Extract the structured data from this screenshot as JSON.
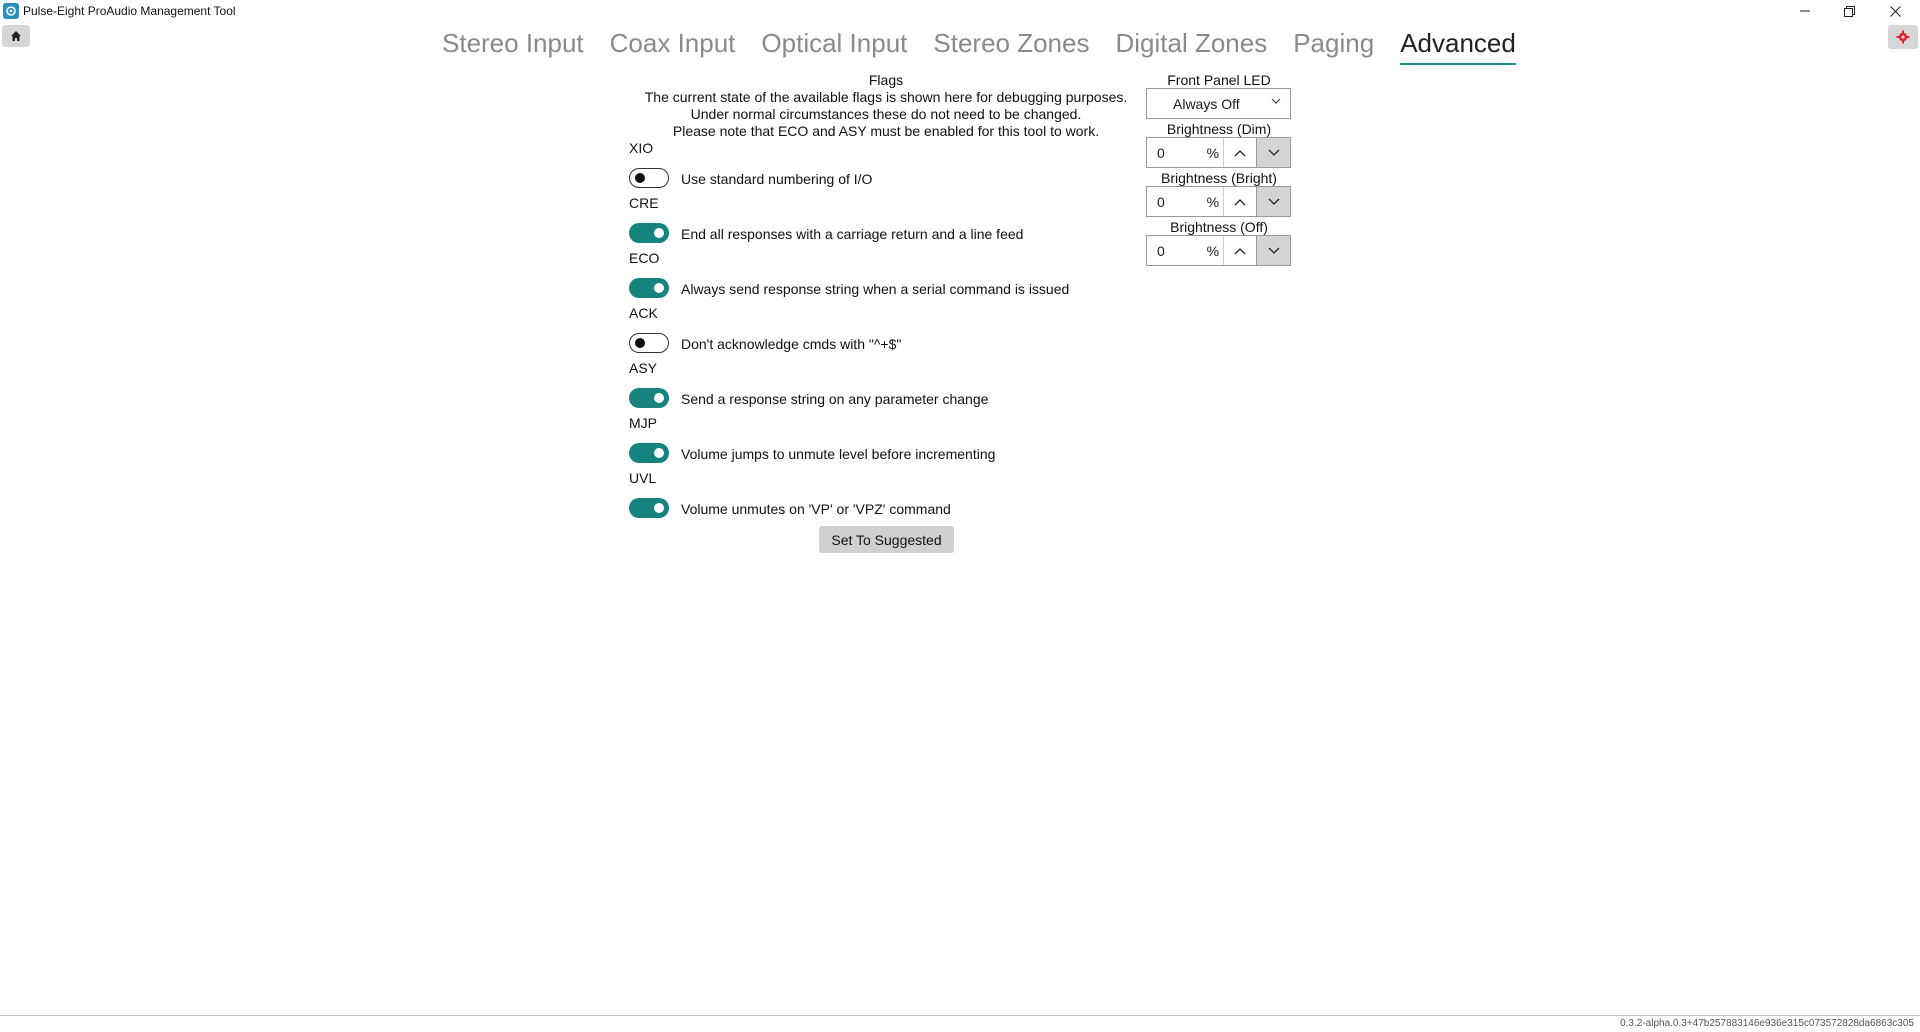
{
  "window": {
    "title": "Pulse-Eight ProAudio Management Tool",
    "minimize": "—",
    "maximize": "❐",
    "close": "✕"
  },
  "toolbar": {
    "home_icon": "home-icon",
    "settings_icon": "gear-icon"
  },
  "tabs": [
    {
      "label": "Stereo Input",
      "active": false
    },
    {
      "label": "Coax Input",
      "active": false
    },
    {
      "label": "Optical Input",
      "active": false
    },
    {
      "label": "Stereo Zones",
      "active": false
    },
    {
      "label": "Digital Zones",
      "active": false
    },
    {
      "label": "Paging",
      "active": false
    },
    {
      "label": "Advanced",
      "active": true
    }
  ],
  "flags": {
    "title": "Flags",
    "desc1": "The current state of the available flags is shown here for debugging purposes.",
    "desc2": "Under normal circumstances these do not need to be changed.",
    "desc3": "Please note that ECO and ASY must be enabled for this tool to work.",
    "items": [
      {
        "code": "XIO",
        "on": false,
        "label": "Use standard numbering of I/O"
      },
      {
        "code": "CRE",
        "on": true,
        "label": "End all responses with a carriage return and a line feed"
      },
      {
        "code": "ECO",
        "on": true,
        "label": "Always send response string when a serial command is issued"
      },
      {
        "code": "ACK",
        "on": false,
        "label": "Don't acknowledge cmds with \"^+$\""
      },
      {
        "code": "ASY",
        "on": true,
        "label": "Send a response string on any parameter change"
      },
      {
        "code": "MJP",
        "on": true,
        "label": "Volume jumps to unmute level before incrementing"
      },
      {
        "code": "UVL",
        "on": true,
        "label": "Volume unmutes on 'VP' or 'VPZ' command"
      }
    ],
    "suggest_button": "Set To Suggested"
  },
  "led": {
    "title": "Front Panel LED",
    "mode": "Always Off",
    "dim_label": "Brightness (Dim)",
    "dim_value": "0",
    "bright_label": "Brightness (Bright)",
    "bright_value": "0",
    "off_label": "Brightness (Off)",
    "off_value": "0",
    "unit": "%"
  },
  "footer": {
    "version": "0.3.2-alpha.0.3+47b257883146e936e315c073572828da6863c305"
  },
  "colors": {
    "accent": "#16837f",
    "settings_icon": "#e0202a"
  }
}
